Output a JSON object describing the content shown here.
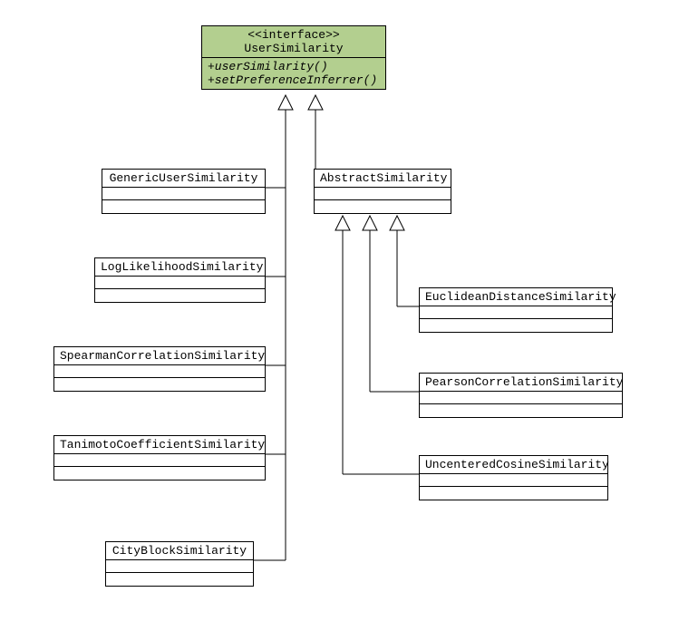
{
  "interface": {
    "stereotype": "<<interface>>",
    "name": "UserSimilarity",
    "methods": [
      "+userSimilarity()",
      "+setPreferenceInferrer()"
    ]
  },
  "classes": {
    "generic": {
      "name": "GenericUserSimilarity"
    },
    "loglike": {
      "name": "LogLikelihoodSimilarity"
    },
    "spearman": {
      "name": "SpearmanCorrelationSimilarity"
    },
    "tanimoto": {
      "name": "TanimotoCoefficientSimilarity"
    },
    "cityblock": {
      "name": "CityBlockSimilarity"
    },
    "abstract": {
      "name": "AbstractSimilarity"
    },
    "euclidean": {
      "name": "EuclideanDistanceSimilarity"
    },
    "pearson": {
      "name": "PearsonCorrelationSimilarity"
    },
    "uncentered": {
      "name": "UncenteredCosineSimilarity"
    }
  }
}
